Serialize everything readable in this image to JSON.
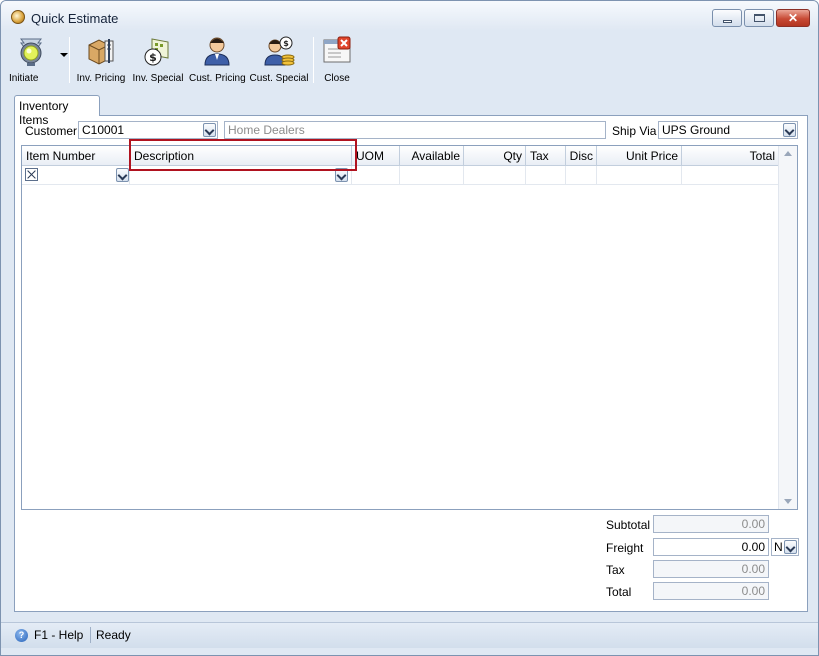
{
  "window": {
    "title": "Quick Estimate"
  },
  "toolbar": {
    "items": [
      {
        "label": "Initiate",
        "icon": "traffic-light-icon"
      },
      {
        "label": "Inv. Pricing",
        "icon": "inventory-pricing-icon"
      },
      {
        "label": "Inv. Special",
        "icon": "inventory-special-icon"
      },
      {
        "label": "Cust. Pricing",
        "icon": "customer-pricing-icon"
      },
      {
        "label": "Cust. Special",
        "icon": "customer-special-icon"
      },
      {
        "label": "Close",
        "icon": "close-form-icon"
      }
    ]
  },
  "tabs": [
    {
      "label": "Inventory Items",
      "active": true
    }
  ],
  "form": {
    "customer_label": "Customer",
    "customer_value": "C10001",
    "customer_name": "Home Dealers",
    "ship_via_label": "Ship Via",
    "ship_via_value": "UPS Ground"
  },
  "grid": {
    "columns": [
      "Item Number",
      "Description",
      "UOM",
      "Available",
      "Qty",
      "Tax",
      "Disc",
      "Unit Price",
      "Total"
    ],
    "rows": [
      {
        "item_number": "",
        "description": ""
      }
    ]
  },
  "totals": {
    "subtotal_label": "Subtotal",
    "subtotal_value": "0.00",
    "freight_label": "Freight",
    "freight_value": "0.00",
    "freight_option": "N",
    "tax_label": "Tax",
    "tax_value": "0.00",
    "total_label": "Total",
    "total_value": "0.00"
  },
  "status": {
    "help": "F1 - Help",
    "state": "Ready"
  },
  "colors": {
    "highlight_border": "#b0121f",
    "window_bg": "#dfe8f3",
    "close_button": "#c84a35"
  }
}
